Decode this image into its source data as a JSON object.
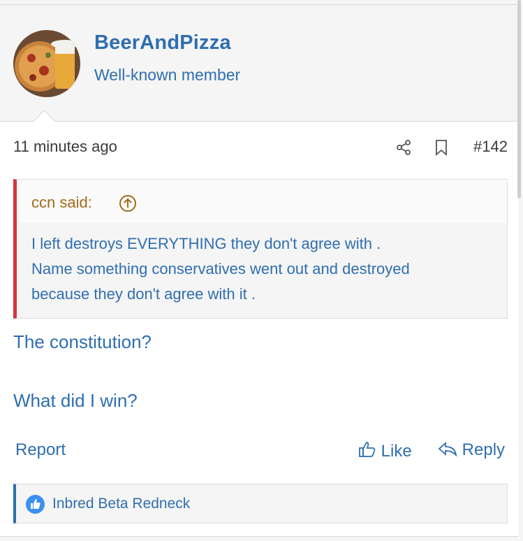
{
  "user": {
    "username": "BeerAndPizza",
    "title": "Well-known member"
  },
  "meta": {
    "time": "11 minutes ago",
    "post_number": "#142",
    "share_icon": "share-icon",
    "bookmark_icon": "bookmark-icon"
  },
  "quote": {
    "author": "ccn said:",
    "up_icon": "arrow-up-circle-icon",
    "lines": [
      "I left destroys EVERYTHING they don't agree with .",
      "Name something conservatives went out and destroyed",
      "because they don't agree with it ."
    ]
  },
  "body": {
    "line1": "The constitution?",
    "line2": "What did I win?"
  },
  "actions": {
    "report": "Report",
    "like": "Like",
    "reply": "Reply"
  },
  "reactions": {
    "text": "Inbred Beta Redneck"
  },
  "colors": {
    "link": "#2f6eb0",
    "quote_accent": "#d23440",
    "quote_author": "#a36a17",
    "reaction_badge": "#3a8ff0"
  }
}
